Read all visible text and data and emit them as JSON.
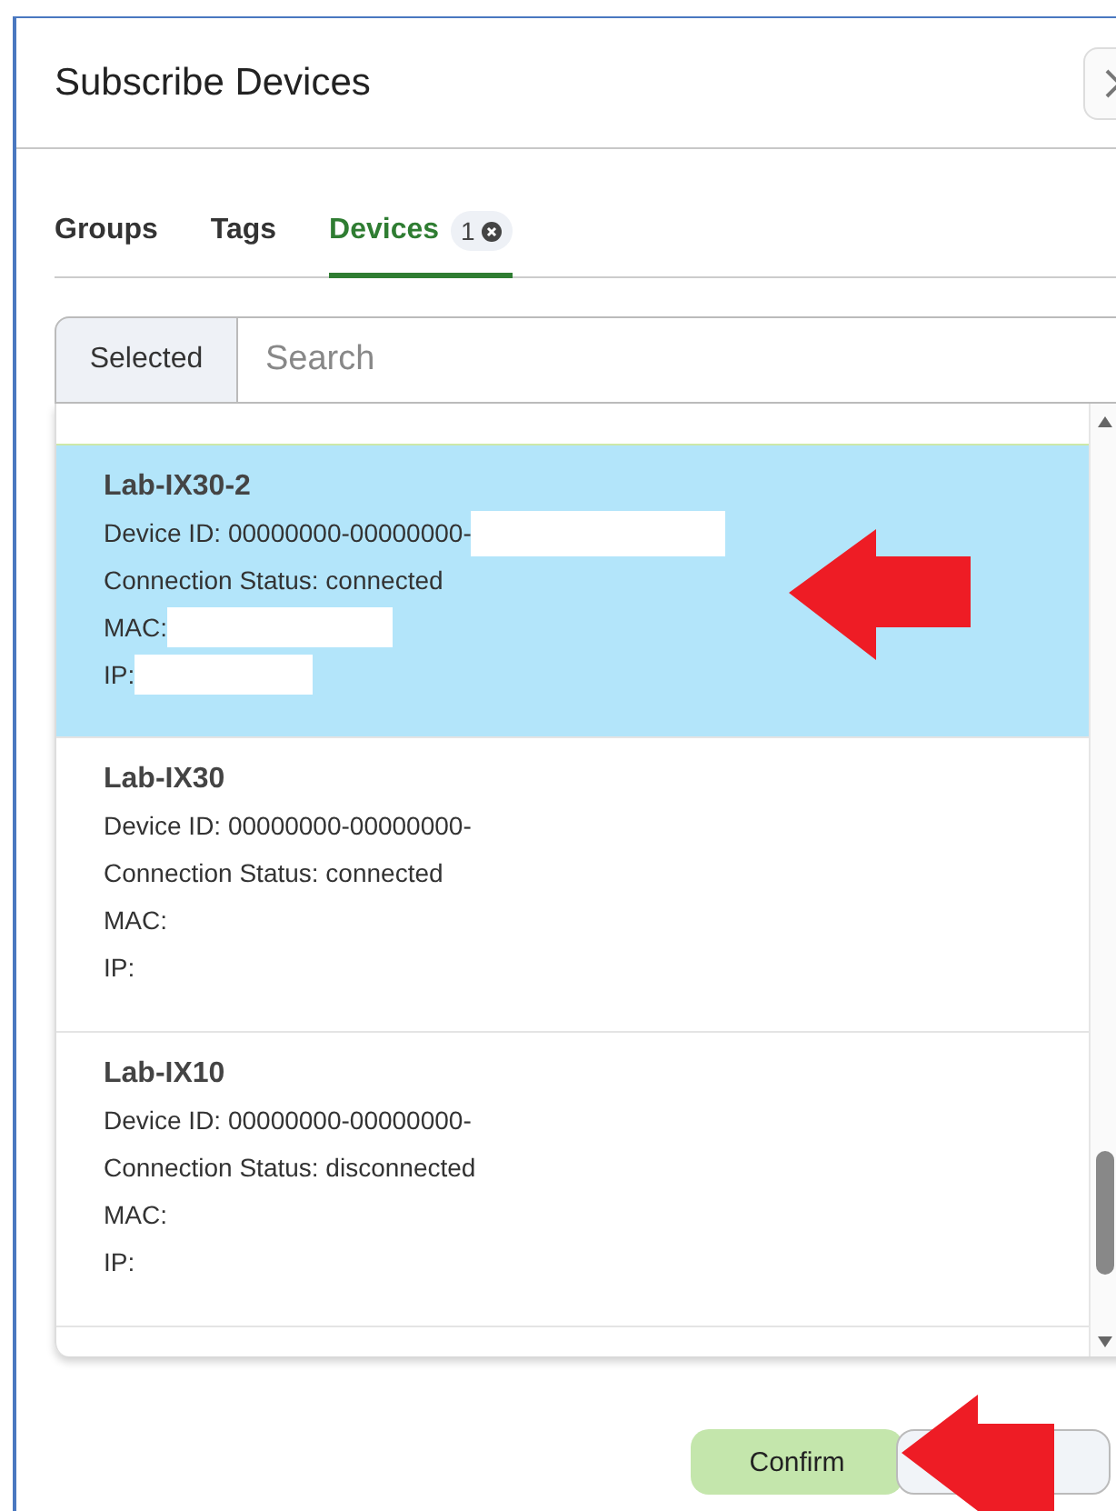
{
  "dialog": {
    "title": "Subscribe Devices"
  },
  "tabs": [
    {
      "label": "Groups",
      "selected": false
    },
    {
      "label": "Tags",
      "selected": false
    },
    {
      "label": "Devices",
      "selected": true,
      "count": "1"
    }
  ],
  "filter": {
    "toggle": "Selected",
    "placeholder": "Search"
  },
  "devices": [
    {
      "name": "Lab-IX30-2",
      "selected": true,
      "lines": [
        {
          "text": "Device ID: 00000000-00000000-",
          "redacted": true
        },
        {
          "text": "Connection Status: connected"
        },
        {
          "text": "MAC:",
          "redacted": true
        },
        {
          "text": "IP:",
          "redacted": true
        }
      ]
    },
    {
      "name": "Lab-IX30",
      "selected": false,
      "lines": [
        {
          "text": "Device ID: 00000000-00000000-"
        },
        {
          "text": "Connection Status: connected"
        },
        {
          "text": "MAC:"
        },
        {
          "text": "IP:"
        }
      ]
    },
    {
      "name": "Lab-IX10",
      "selected": false,
      "lines": [
        {
          "text": "Device ID: 00000000-00000000-"
        },
        {
          "text": "Connection Status: disconnected"
        },
        {
          "text": "MAC:"
        },
        {
          "text": "IP:"
        }
      ]
    }
  ],
  "buttons": [
    {
      "label": "Confirm",
      "kind": "primary"
    },
    {
      "kind": "secondary"
    }
  ]
}
